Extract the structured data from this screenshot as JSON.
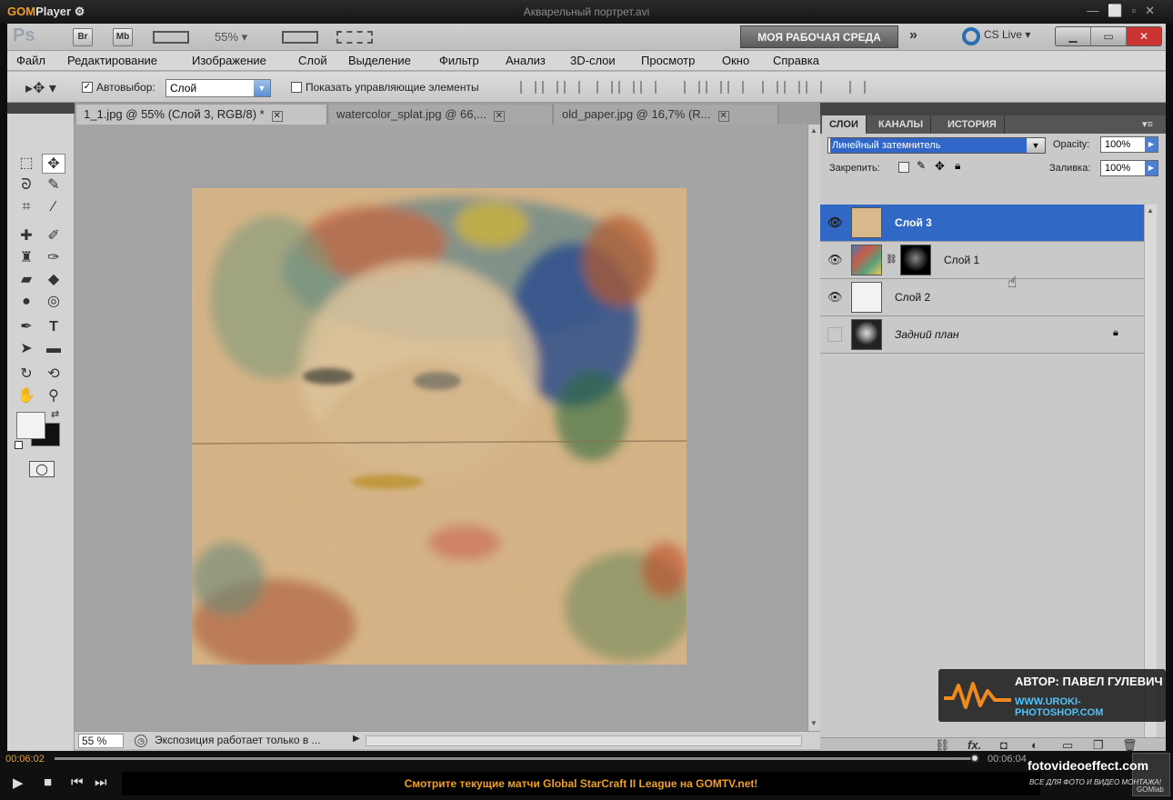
{
  "player": {
    "logo_a": "GOM",
    "logo_b": "Player",
    "file_title": "Акварельный портрет.avi",
    "time_current": "00:06:02",
    "time_total": "00:06:04",
    "ticker_text": "Смотрите текущие матчи Global StarCraft II League на GOMTV.net!",
    "overlay_brand": "fotovideoeffect.com",
    "overlay_tagline": "ВСЕ ДЛЯ ФОТО И ВИДЕО МОНТАЖА!",
    "gomlab_label": "GOMlab",
    "progress_fraction": 0.995
  },
  "photoshop": {
    "logo": "Ps",
    "appbar_icons": [
      "Br",
      "Mb"
    ],
    "zoom_value": "55%",
    "workspace_label": "МОЯ РАБОЧАЯ СРЕДА",
    "cs_live": "CS Live",
    "menu": [
      "Файл",
      "Редактирование",
      "Изображение",
      "Слой",
      "Выделение",
      "Фильтр",
      "Анализ",
      "3D-слои",
      "Просмотр",
      "Окно",
      "Справка"
    ],
    "options": {
      "autoselect_label": "Автовыбор:",
      "autoselect_value": "Слой",
      "show_controls_label": "Показать управляющие элементы"
    },
    "doc_tabs": [
      {
        "label": "1_1.jpg @ 55% (Слой 3, RGB/8) *",
        "active": true
      },
      {
        "label": "watercolor_splat.jpg @ 66,...",
        "active": false
      },
      {
        "label": "old_paper.jpg @ 16,7% (R...",
        "active": false
      }
    ],
    "status": {
      "zoom": "55 %",
      "message": "Экспозиция работает только в ..."
    },
    "panel_tabs": [
      "СЛОИ",
      "КАНАЛЫ",
      "ИСТОРИЯ"
    ],
    "blend_mode": "Линейный затемнитель",
    "opacity_label": "Opacity:",
    "opacity_value": "100%",
    "lock_label": "Закрепить:",
    "fill_label": "Заливка:",
    "fill_value": "100%",
    "layers": [
      {
        "name": "Слой 3",
        "selected": true,
        "visible": true
      },
      {
        "name": "Слой 1",
        "selected": false,
        "visible": true
      },
      {
        "name": "Слой 2",
        "selected": false,
        "visible": true
      },
      {
        "name": "Задний план",
        "selected": false,
        "visible": false
      }
    ],
    "panel_bottom_icons": [
      "link-icon",
      "fx-icon",
      "mask-icon",
      "adjustment-icon",
      "group-icon",
      "new-layer-icon",
      "trash-icon"
    ],
    "panel_bottom_fx": "fx."
  },
  "watermark": {
    "author": "АВТОР: ПАВЕЛ ГУЛЕВИЧ",
    "site": "WWW.UROKI-PHOTOSHOP.COM"
  },
  "colors": {
    "selection_blue": "#3168c5",
    "gom_orange": "#f0a020",
    "paper": "#d9b98c"
  }
}
